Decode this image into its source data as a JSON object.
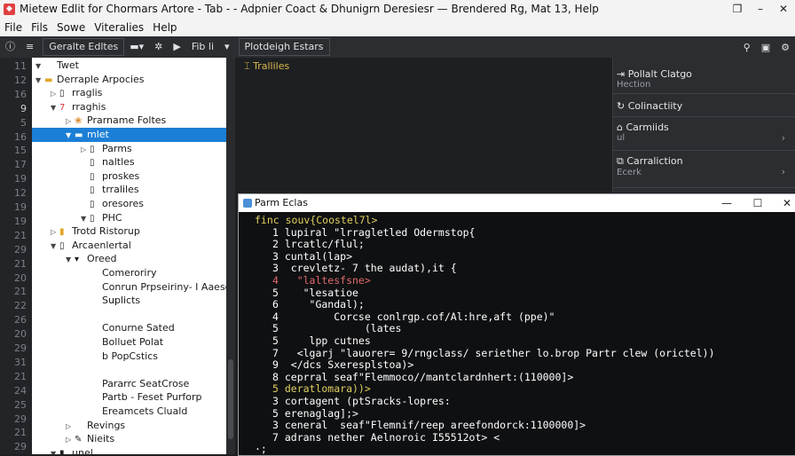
{
  "window": {
    "title": "Mietew Edlit for Chormars Artore - Tab - - Adpnier Coact & Dhunigrn Deresiesr — Brendered Rg, Mat 13, Help"
  },
  "menu": [
    "File",
    "Fils",
    "Sowe",
    "Viteralies",
    "Help"
  ],
  "toolbar": {
    "project_label": "Geralte Edltes",
    "run_label": "Fib li",
    "tab_label": "Plotdeigh Estars"
  },
  "gutter": [
    {
      "n": "11"
    },
    {
      "n": "12"
    },
    {
      "n": "16"
    },
    {
      "n": "9",
      "current": true
    },
    {
      "n": "5"
    },
    {
      "n": "16"
    },
    {
      "n": "15"
    },
    {
      "n": "17"
    },
    {
      "n": "19"
    },
    {
      "n": "12"
    },
    {
      "n": "19"
    },
    {
      "n": "19"
    },
    {
      "n": "21"
    },
    {
      "n": "29"
    },
    {
      "n": "21"
    },
    {
      "n": "20"
    },
    {
      "n": "21"
    },
    {
      "n": "22"
    },
    {
      "n": "26"
    },
    {
      "n": "20"
    },
    {
      "n": "29"
    },
    {
      "n": "31"
    },
    {
      "n": "21"
    },
    {
      "n": "24"
    },
    {
      "n": "25"
    },
    {
      "n": "29"
    },
    {
      "n": "21"
    },
    {
      "n": "29"
    }
  ],
  "tree": [
    {
      "depth": 0,
      "arrow": "▼",
      "icon": "",
      "label": "Twet"
    },
    {
      "depth": 0,
      "arrow": "▼",
      "icon": "▬",
      "label": "Derraple Arpocies",
      "color": "#e0a52a"
    },
    {
      "depth": 1,
      "arrow": "▷",
      "icon": "▯",
      "label": "rraglis"
    },
    {
      "depth": 1,
      "arrow": "▼",
      "icon": "7",
      "label": "rraghis",
      "color": "#d33"
    },
    {
      "depth": 2,
      "arrow": "▷",
      "icon": "❀",
      "label": "Prarname Foltes",
      "color": "#d88a2a"
    },
    {
      "depth": 2,
      "arrow": "▼",
      "icon": "▬",
      "label": "mlet",
      "selected": true
    },
    {
      "depth": 3,
      "arrow": "▷",
      "icon": "▯",
      "label": "Parms"
    },
    {
      "depth": 3,
      "arrow": "",
      "icon": "▯",
      "label": "naltles"
    },
    {
      "depth": 3,
      "arrow": "",
      "icon": "▯",
      "label": "proskes"
    },
    {
      "depth": 3,
      "arrow": "",
      "icon": "▯",
      "label": "trraliles"
    },
    {
      "depth": 3,
      "arrow": "",
      "icon": "▯",
      "label": "oresores"
    },
    {
      "depth": 3,
      "arrow": "▼",
      "icon": "▯",
      "label": "PHC"
    },
    {
      "depth": 1,
      "arrow": "▷",
      "icon": "▮",
      "label": "Trotd Ristorup",
      "color": "#e0a52a"
    },
    {
      "depth": 1,
      "arrow": "▼",
      "icon": "▯",
      "label": "Arcaenlertal"
    },
    {
      "depth": 2,
      "arrow": "▼",
      "icon": "▾",
      "label": "Oreed"
    },
    {
      "depth": 3,
      "arrow": "",
      "icon": "",
      "label": "Comeroriry"
    },
    {
      "depth": 3,
      "arrow": "",
      "icon": "",
      "label": "Conrun Prpseiriny- I Aaesct"
    },
    {
      "depth": 3,
      "arrow": "",
      "icon": "",
      "label": "Suplicts"
    },
    {
      "depth": 3,
      "arrow": "",
      "icon": "",
      "label": ""
    },
    {
      "depth": 3,
      "arrow": "",
      "icon": "",
      "label": "Conurne Sated"
    },
    {
      "depth": 3,
      "arrow": "",
      "icon": "",
      "label": "Bolluet Polat"
    },
    {
      "depth": 3,
      "arrow": "",
      "icon": "",
      "label": "b PopCstics"
    },
    {
      "depth": 3,
      "arrow": "",
      "icon": "",
      "label": ""
    },
    {
      "depth": 3,
      "arrow": "",
      "icon": "",
      "label": "Pararrc SeatCrose"
    },
    {
      "depth": 3,
      "arrow": "",
      "icon": "",
      "label": "Partb - Feset Purforp"
    },
    {
      "depth": 3,
      "arrow": "",
      "icon": "",
      "label": "Ereamcets Cluald"
    },
    {
      "depth": 2,
      "arrow": "▷",
      "icon": "",
      "label": "Revings"
    },
    {
      "depth": 2,
      "arrow": "▷",
      "icon": "✎",
      "label": "Nieits"
    },
    {
      "depth": 1,
      "arrow": "▼",
      "icon": "▮",
      "label": "unel"
    }
  ],
  "editor": {
    "file_label": "Tralliles"
  },
  "right_panel": [
    {
      "header": "Pollalt Clatgo",
      "sub": "Hection",
      "icon": "⇥"
    },
    {
      "header": "Colinactiity",
      "sub": "",
      "icon": "↻"
    },
    {
      "header": "Carmiids",
      "sub": "ul",
      "icon": "⌂",
      "chev": true
    },
    {
      "header": "Carraliction",
      "sub": "Ecerk",
      "icon": "⧉",
      "chev": true
    }
  ],
  "dialog": {
    "title": "Parm Eclas",
    "code": [
      {
        "indent": 0,
        "text": "finc souv{Coostel7l>",
        "color": "#e0d060"
      },
      {
        "indent": 2,
        "text": "1 lupiral \"lrragletled Odermstop{",
        "color": "#ffffff"
      },
      {
        "indent": 2,
        "text": "2 lrcatlc/flul;",
        "color": "#ffffff"
      },
      {
        "indent": 2,
        "text": "3 cuntal(lap>",
        "color": "#ffffff"
      },
      {
        "indent": 2,
        "text": "3  crevletz- 7 the audat),it {",
        "color": "#ffffff"
      },
      {
        "indent": 2,
        "text": "4   \"laltesfsne>",
        "color": "#e26a6a"
      },
      {
        "indent": 2,
        "text": "5    \"lesatioe",
        "color": "#ffffff"
      },
      {
        "indent": 2,
        "text": "6     \"Gandal);",
        "color": "#ffffff"
      },
      {
        "indent": 2,
        "text": "4         Corcse conlrgp.cof/Al:hre,aft (ppe)\"",
        "color": "#ffffff"
      },
      {
        "indent": 2,
        "text": "5              (lates",
        "color": "#ffffff"
      },
      {
        "indent": 2,
        "text": "5     lpp cutnes",
        "color": "#ffffff"
      },
      {
        "indent": 2,
        "text": "7   <lgarj \"lauorer= 9/rngclass/ seriether lo.brop Partr clew (orictel))",
        "color": "#ffffff"
      },
      {
        "indent": 2,
        "text": "9  </dcs Sxeresplstoa)>",
        "color": "#ffffff"
      },
      {
        "indent": 2,
        "text": "8 ceprral seaf\"Flemmoco//mantclardnhert:(110000]>",
        "color": "#ffffff"
      },
      {
        "indent": 2,
        "text": "5 deratlomara))>",
        "color": "#e0d060"
      },
      {
        "indent": 2,
        "text": "3 cortagent (ptSracks-lopres:",
        "color": "#ffffff"
      },
      {
        "indent": 2,
        "text": "5 erenaglag];>",
        "color": "#ffffff"
      },
      {
        "indent": 2,
        "text": "3 ceneral  seaf\"Flemnif/reep areefondorck:1100000]>",
        "color": "#ffffff"
      },
      {
        "indent": 2,
        "text": "7 adrans nether Aelnoroic I55512ot> <",
        "color": "#ffffff"
      },
      {
        "indent": 0,
        "text": "·;",
        "color": "#ffffff"
      }
    ]
  },
  "colors": {
    "selection": "#1c7fd6",
    "editor_bg": "#1e1f22",
    "dialog_bg": "#0f1012",
    "accent_yellow": "#d9b84a"
  }
}
